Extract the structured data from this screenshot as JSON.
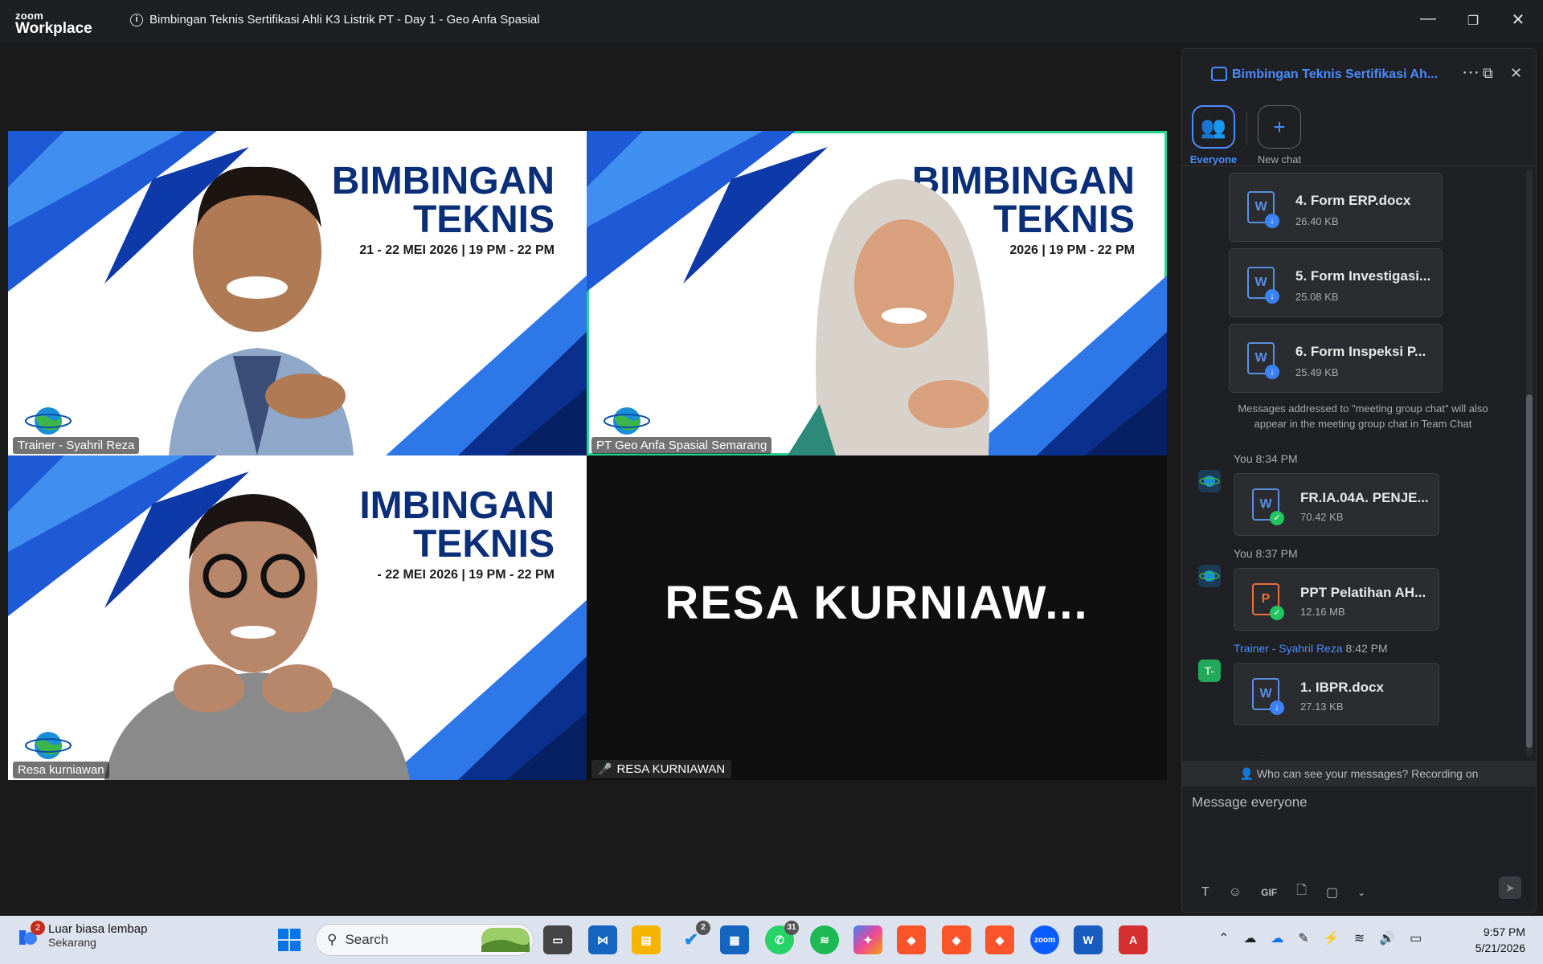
{
  "window": {
    "brand_top": "zoom",
    "brand_bottom": "Workplace",
    "title": "Bimbingan Teknis Sertifikasi Ahli K3 Listrik PT - Day 1 - Geo Anfa Spasial",
    "minimize": "—",
    "restore": "❐",
    "close": "✕"
  },
  "tiles": [
    {
      "name": "Trainer - Syahril Reza",
      "banner_line1": "BIMBINGAN",
      "banner_line2": "TEKNIS",
      "date": "21 - 22 MEI 2026 | 19 PM - 22 PM"
    },
    {
      "name": "PT Geo Anfa Spasial Semarang",
      "banner_line1": "BIMBINGAN",
      "banner_line2": "TEKNIS",
      "date": "2026 | 19 PM - 22 PM"
    },
    {
      "name": "Resa kurniawan",
      "banner_line1": "IMBINGAN",
      "banner_line2": "TEKNIS",
      "date": "- 22 MEI 2026 | 19 PM - 22 PM"
    },
    {
      "name": "RESA KURNIAWAN",
      "avatar_text": "RESA  KURNIAW..."
    }
  ],
  "chat": {
    "title": "Bimbingan Teknis Sertifikasi Ah...",
    "tabs": [
      {
        "label": "Everyone"
      },
      {
        "label": "New chat"
      }
    ],
    "files_top": [
      {
        "name": "4. Form ERP.docx",
        "size": "26.40 KB"
      },
      {
        "name": "5. Form Investigasi...",
        "size": "25.08 KB"
      },
      {
        "name": "6. Form Inspeksi P...",
        "size": "25.49 KB"
      }
    ],
    "system_note": "Messages addressed to \"meeting group chat\" will also appear in the meeting group chat in Team Chat",
    "messages": [
      {
        "sender": "You",
        "time": "8:34 PM",
        "file": "FR.IA.04A. PENJE...",
        "size": "70.42 KB"
      },
      {
        "sender": "You",
        "time": "8:37 PM",
        "file": "PPT Pelatihan AH...",
        "size": "12.16 MB"
      },
      {
        "sender": "Trainer - Syahril Reza",
        "time": "8:42 PM",
        "file": "1. IBPR.docx",
        "size": "27.13 KB",
        "avatar": "T-"
      }
    ],
    "visibility": "Who can see your messages? Recording on",
    "placeholder": "Message everyone",
    "gif_label": "GIF"
  },
  "taskbar": {
    "weather_title": "Luar biasa lembap",
    "weather_sub": "Sekarang",
    "weather_badge": "2",
    "search": "Search",
    "badge_todo": "2",
    "badge_whatsapp": "31",
    "time": "9:57 PM",
    "date": "5/21/2026"
  },
  "colors": {
    "accent": "#4a8cff",
    "active_speaker": "#2ad391",
    "banner_blue": "#0b2e78"
  }
}
